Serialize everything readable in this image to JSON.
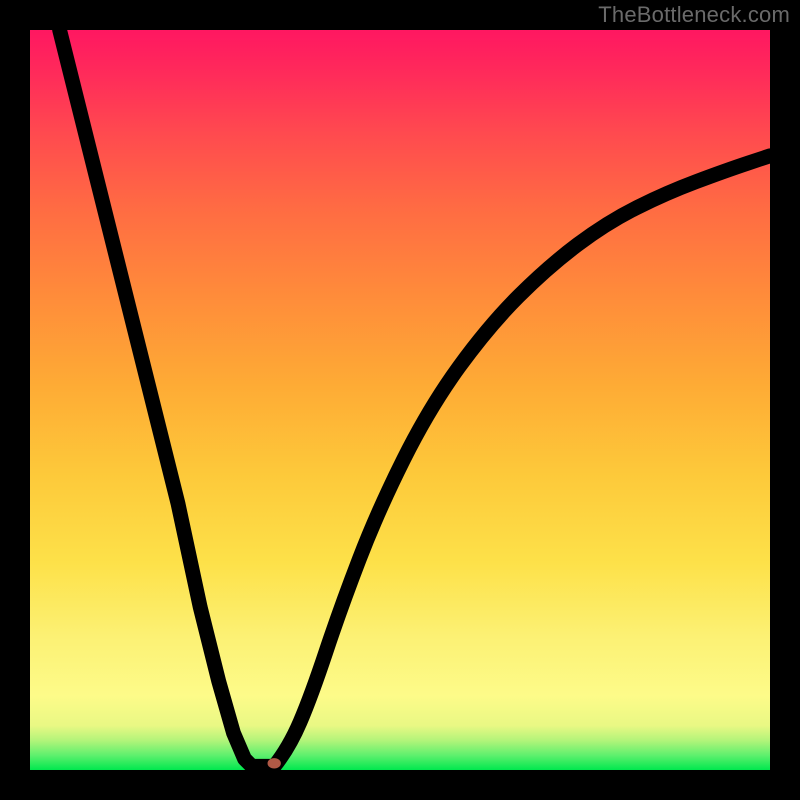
{
  "watermark": "TheBottleneck.com",
  "chart_data": {
    "type": "line",
    "title": "",
    "xlabel": "",
    "ylabel": "",
    "xlim": [
      0,
      100
    ],
    "ylim": [
      0,
      100
    ],
    "grid": false,
    "legend": false,
    "background_gradient": {
      "direction": "vertical",
      "stops": [
        {
          "pos": 0,
          "color": "#00e84e"
        },
        {
          "pos": 10,
          "color": "#fdfb89"
        },
        {
          "pos": 28,
          "color": "#fde149"
        },
        {
          "pos": 52,
          "color": "#feab35"
        },
        {
          "pos": 76,
          "color": "#ff6b43"
        },
        {
          "pos": 100,
          "color": "#ff1761"
        }
      ]
    },
    "series": [
      {
        "name": "left-branch",
        "x": [
          4,
          8,
          12,
          16,
          20,
          23,
          25.5,
          27.5,
          29,
          30
        ],
        "y": [
          100,
          84,
          68,
          52,
          36,
          22,
          12,
          5,
          1.5,
          0.5
        ]
      },
      {
        "name": "floor",
        "x": [
          30,
          33
        ],
        "y": [
          0.5,
          0.5
        ]
      },
      {
        "name": "right-branch",
        "x": [
          33,
          35,
          38,
          42,
          47,
          54,
          62,
          70,
          78,
          86,
          94,
          100
        ],
        "y": [
          0.5,
          3,
          10,
          22,
          35,
          49,
          60,
          68,
          74,
          78,
          81,
          83
        ]
      }
    ],
    "marker": {
      "name": "minimum-point",
      "x": 33,
      "y": 0.9,
      "rx": 0.9,
      "ry": 0.7,
      "color": "#b15946"
    }
  }
}
